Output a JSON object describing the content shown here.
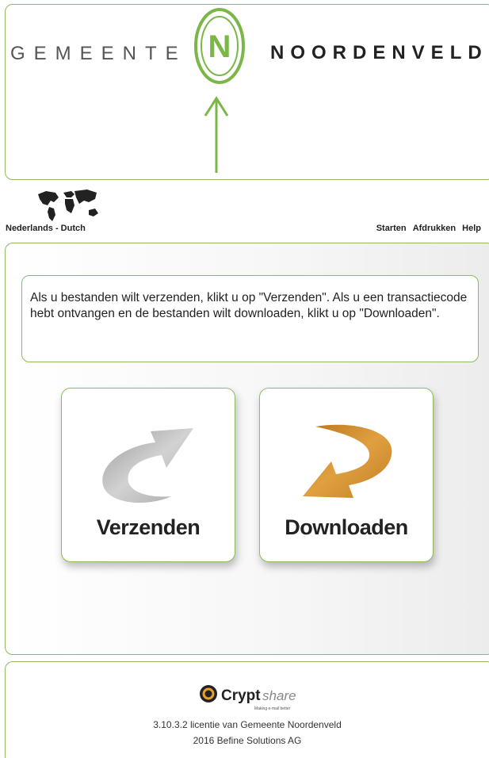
{
  "header": {
    "brand_left": "GEMEENTE",
    "brand_right": "NOORDENVELD",
    "logo_letter": "N",
    "colors": {
      "accent": "#7ab648",
      "text": "#555555"
    }
  },
  "language": {
    "label": "Nederlands - Dutch",
    "icon": "world-map-icon"
  },
  "topnav": {
    "start": "Starten",
    "print": "Afdrukken",
    "help": "Help"
  },
  "main": {
    "info_text": "Als u bestanden wilt verzenden, klikt u op \"Verzenden\". Als u een transactiecode hebt ontvangen en de bestanden wilt downloaden, klikt u op \"Downloaden\".",
    "send_label": "Verzenden",
    "download_label": "Downloaden",
    "send_icon": "send-arrow-icon",
    "download_icon": "download-arrow-icon",
    "colors": {
      "send_arrow": "#b8b8b8",
      "download_arrow": "#d4902a",
      "border": "#8bbd5a"
    }
  },
  "footer": {
    "logo_text_bold": "Crypt",
    "logo_text_italic": "share",
    "logo_tagline": "Making e-mail better",
    "license": "3.10.3.2 licentie van Gemeente Noordenveld",
    "copyright": "2016 Befine Solutions AG"
  }
}
